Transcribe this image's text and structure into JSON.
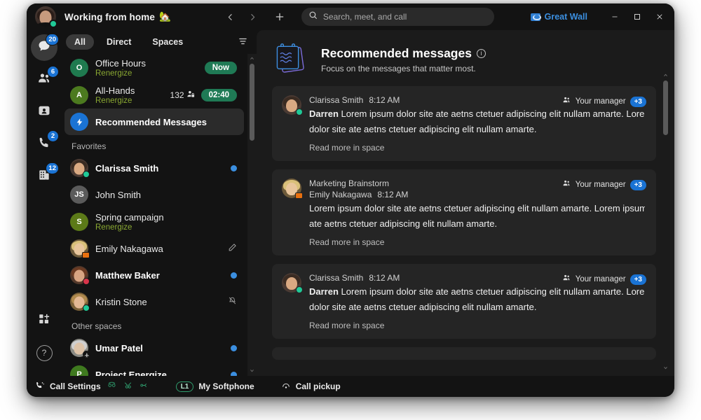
{
  "titlebar": {
    "status_text": "Working from home",
    "status_emoji": "🏡",
    "back_icon": "chevron-left-icon",
    "forward_icon": "chevron-right-icon",
    "plus_icon": "plus-icon",
    "search_placeholder": "Search, meet, and call",
    "search_icon": "search-icon",
    "org_label": "Great Wall",
    "minimize_label": "—",
    "maximize_label": "⬜",
    "close_label": "✕"
  },
  "rail": {
    "items": [
      {
        "name": "messages",
        "icon": "chat-bubble-icon",
        "badge": "20",
        "active": true
      },
      {
        "name": "teams",
        "icon": "people-icon",
        "badge": "6",
        "active": false
      },
      {
        "name": "contacts",
        "icon": "contact-card-icon",
        "badge": "",
        "active": false
      },
      {
        "name": "calls",
        "icon": "phone-icon",
        "badge": "2",
        "active": false
      },
      {
        "name": "workspaces",
        "icon": "building-icon",
        "badge": "12",
        "active": false
      }
    ],
    "bottom": [
      {
        "name": "apps",
        "icon": "apps-grid-plus-icon"
      },
      {
        "name": "help",
        "icon": "question-mark-icon"
      }
    ]
  },
  "sidebar": {
    "filters": [
      {
        "label": "All",
        "active": true
      },
      {
        "label": "Direct",
        "active": false
      },
      {
        "label": "Spaces",
        "active": false
      }
    ],
    "filter_icon": "filter-lines-icon",
    "meetings": [
      {
        "initial": "O",
        "avatar_color": "#1f7a4f",
        "title": "Office Hours",
        "subtitle": "Renergize",
        "pill": "Now",
        "count": ""
      },
      {
        "initial": "A",
        "avatar_color": "#4c7a1f",
        "title": "All-Hands",
        "subtitle": "Renergize",
        "pill": "02:40",
        "count": "132"
      }
    ],
    "recommended": {
      "label": "Recommended Messages",
      "icon": "lightning-bolt-icon",
      "selected": true
    },
    "favorites_label": "Favorites",
    "favorites": [
      {
        "name": "Clarissa Smith",
        "bold": true,
        "unread": true,
        "presence": "available",
        "avatar": "photo",
        "skin": "#d9a982",
        "hair": "#3a2b22",
        "sub": "",
        "trailing": ""
      },
      {
        "name": "John Smith",
        "bold": false,
        "unread": false,
        "presence": "none",
        "avatar": "initials",
        "initials": "JS",
        "avatar_color": "#5b5b5b",
        "sub": "",
        "trailing": ""
      },
      {
        "name": "Spring campaign",
        "bold": false,
        "unread": false,
        "presence": "none",
        "avatar": "initials",
        "initials": "S",
        "avatar_color": "#5c7a18",
        "sub": "Renergize",
        "trailing": ""
      },
      {
        "name": "Emily Nakagawa",
        "bold": false,
        "unread": false,
        "presence": "presenting",
        "avatar": "photo",
        "skin": "#e8c59c",
        "hair": "#d9c07a",
        "sub": "",
        "trailing": "draft-pencil-icon"
      },
      {
        "name": "Matthew Baker",
        "bold": true,
        "unread": true,
        "presence": "dnd",
        "avatar": "photo",
        "skin": "#d8a482",
        "hair": "#6b3a22",
        "sub": "",
        "trailing": ""
      },
      {
        "name": "Kristin Stone",
        "bold": false,
        "unread": false,
        "presence": "available",
        "avatar": "photo",
        "skin": "#e3b894",
        "hair": "#b08a4e",
        "sub": "",
        "trailing": "bell-muted-icon"
      }
    ],
    "other_label": "Other spaces",
    "other": [
      {
        "name": "Umar Patel",
        "bold": true,
        "unread": true,
        "presence": "ooo",
        "avatar": "photo",
        "skin": "#ddc3a8",
        "hair": "#cfcfcf",
        "sub": "",
        "trailing": ""
      },
      {
        "name": "Project Energize",
        "bold": true,
        "unread": true,
        "presence": "none",
        "avatar": "initials",
        "initials": "P",
        "avatar_color": "#3f7a1f",
        "sub": "",
        "trailing": ""
      }
    ]
  },
  "main": {
    "header_icon": "notepad-icon",
    "title": "Recommended messages",
    "info_icon": "info-icon",
    "subtitle": "Focus on the messages that matter most.",
    "messages": [
      {
        "space": "",
        "sender": "Clarissa Smith",
        "time": "8:12 AM",
        "mention": "Darren",
        "line1": " Lorem ipsum dolor site ate aetns ctetuer adipiscing elit nullam amarte. Lorem ipsum",
        "line2": "dolor site ate aetns ctetuer adipiscing elit nullam amarte.",
        "read_more": "Read more in space",
        "tag": "Your manager",
        "tag_icon": "people-icon",
        "extra": "+3",
        "presence": "available",
        "skin": "#d9a982",
        "hair": "#3a2b22"
      },
      {
        "space": "Marketing Brainstorm",
        "sender": "Emily Nakagawa",
        "time": "8:12 AM",
        "mention": "",
        "line1": "Lorem ipsum dolor site ate aetns ctetuer adipiscing elit nullam amarte. Lorem ipsum dolor",
        "line2": "ate aetns ctetuer adipiscing elit nullam amarte.",
        "read_more": "Read more in space",
        "tag": "Your manager",
        "tag_icon": "people-icon",
        "extra": "+3",
        "presence": "presenting",
        "skin": "#e8c59c",
        "hair": "#d9c07a"
      },
      {
        "space": "",
        "sender": "Clarissa Smith",
        "time": "8:12 AM",
        "mention": "Darren",
        "line1": " Lorem ipsum dolor site ate aetns ctetuer adipiscing elit nullam amarte. Lorem ipsum",
        "line2": "dolor site ate aetns ctetuer adipiscing elit nullam amarte.",
        "read_more": "Read more in space",
        "tag": "Your manager",
        "tag_icon": "people-icon",
        "extra": "+3",
        "presence": "available",
        "skin": "#d9a982",
        "hair": "#3a2b22"
      }
    ]
  },
  "statusbar": {
    "call_settings": "Call Settings",
    "call_settings_icon": "phone-settings-icon",
    "extra_icons": [
      "call-forward-icon",
      "call-merge-icon",
      "call-route-icon"
    ],
    "softphone_badge": "L1",
    "softphone_label": "My Softphone",
    "pickup_label": "Call pickup",
    "pickup_icon": "call-pickup-icon"
  },
  "colors": {
    "accent_blue": "#1a73d4",
    "green_pill": "#1f7a55",
    "available": "#20c997",
    "dnd": "#d8344a",
    "presenting": "#e8700f",
    "sub_green": "#8aa832"
  }
}
